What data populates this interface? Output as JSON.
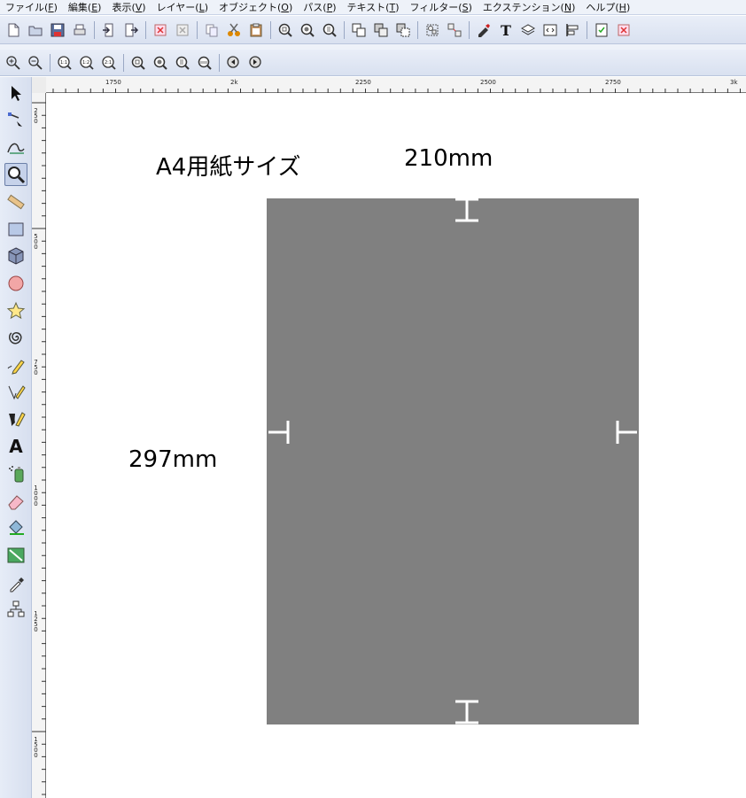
{
  "menubar": {
    "items": [
      {
        "label": "ファイル(",
        "key": "F",
        "end": ")"
      },
      {
        "label": "編集(",
        "key": "E",
        "end": ")"
      },
      {
        "label": "表示(",
        "key": "V",
        "end": ")"
      },
      {
        "label": "レイヤー(",
        "key": "L",
        "end": ")"
      },
      {
        "label": "オブジェクト(",
        "key": "O",
        "end": ")"
      },
      {
        "label": "パス(",
        "key": "P",
        "end": ")"
      },
      {
        "label": "テキスト(",
        "key": "T",
        "end": ")"
      },
      {
        "label": "フィルター(",
        "key": "S",
        "end": ")"
      },
      {
        "label": "エクステンション(",
        "key": "N",
        "end": ")"
      },
      {
        "label": "ヘルプ(",
        "key": "H",
        "end": ")"
      }
    ]
  },
  "toolbar_main": {
    "icons": [
      "new-document-icon",
      "open-icon",
      "save-icon",
      "print-icon",
      "import-icon",
      "export-icon",
      "undo-icon",
      "redo-icon",
      "copy-icon",
      "cut-icon",
      "paste-icon",
      "zoom-selection-icon",
      "zoom-drawing-icon",
      "zoom-page-icon",
      "duplicate-icon",
      "clone-icon",
      "unlink-clone-icon",
      "group-icon",
      "ungroup-icon",
      "fill-stroke-icon",
      "text-font-icon",
      "layers-icon",
      "xml-editor-icon",
      "align-icon",
      "document-properties-icon",
      "preferences-icon"
    ]
  },
  "toolbar_zoom": {
    "icons": [
      "zoom-in-icon",
      "zoom-out-icon",
      "zoom-1-1-icon",
      "zoom-1-2-icon",
      "zoom-2-1-icon",
      "zoom-selection-icon",
      "zoom-drawing-icon",
      "zoom-page-icon",
      "zoom-page-width-icon",
      "zoom-prev-icon",
      "zoom-next-icon"
    ],
    "zoom_1_1": "1:1",
    "zoom_1_2": "1:2",
    "zoom_2_1": "2:1"
  },
  "toolbox": {
    "tools": [
      "selector-tool",
      "node-tool",
      "tweak-tool",
      "zoom-tool",
      "measure-tool",
      "rectangle-tool",
      "3d-box-tool",
      "ellipse-tool",
      "star-tool",
      "spiral-tool",
      "pencil-tool",
      "pen-tool",
      "calligraphy-tool",
      "text-tool",
      "spray-tool",
      "eraser-tool",
      "paint-bucket-tool",
      "gradient-tool",
      "dropper-tool",
      "connector-tool"
    ],
    "active": "zoom-tool",
    "text_tool_glyph": "A"
  },
  "rulers": {
    "horizontal_labels": [
      "1750",
      "2k",
      "2250",
      "2500",
      "2750",
      "3k"
    ],
    "vertical_labels": [
      "250",
      "500",
      "750",
      "1000",
      "1250",
      "1500"
    ]
  },
  "canvas": {
    "title": "A4用紙サイズ",
    "width_label": "210mm",
    "height_label": "297mm",
    "paper_color": "#808080"
  }
}
